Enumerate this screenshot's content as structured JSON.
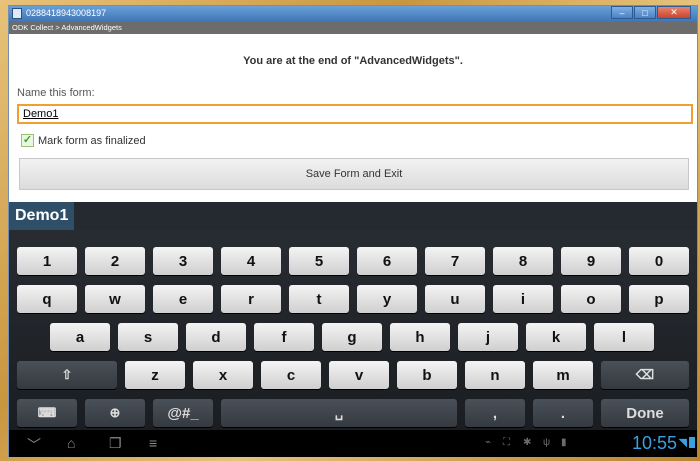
{
  "window": {
    "title": "0288418943008197",
    "minimize": "–",
    "maximize": "□",
    "close": "✕"
  },
  "app_bar": {
    "label": "ODK Collect > AdvancedWidgets"
  },
  "form": {
    "end_message": "You are at the end of \"AdvancedWidgets\".",
    "name_label": "Name this form:",
    "name_value": "Demo1",
    "finalize_label": "Mark form as finalized",
    "finalize_checked": true,
    "save_button": "Save Form and Exit"
  },
  "keyboard": {
    "candidate": "Demo1",
    "row1": [
      "1",
      "2",
      "3",
      "4",
      "5",
      "6",
      "7",
      "8",
      "9",
      "0"
    ],
    "row2": [
      "q",
      "w",
      "e",
      "r",
      "t",
      "y",
      "u",
      "i",
      "o",
      "p"
    ],
    "row3": [
      "a",
      "s",
      "d",
      "f",
      "g",
      "h",
      "j",
      "k",
      "l"
    ],
    "row4": [
      "⇧",
      "z",
      "x",
      "c",
      "v",
      "b",
      "n",
      "m",
      "⌫"
    ],
    "row5": [
      "⌨",
      "⊕",
      "@#_",
      "␣",
      ",",
      ".",
      "Done"
    ]
  },
  "status_bar": {
    "time": "10:55",
    "nav_icons": [
      "back-icon",
      "home-icon",
      "recent-apps-icon",
      "menu-icon"
    ],
    "status_icons": [
      "usb-icon",
      "screenshot-icon",
      "android-debug-icon",
      "usb-connected-icon",
      "sd-card-icon",
      "wifi-icon",
      "battery-icon"
    ]
  }
}
